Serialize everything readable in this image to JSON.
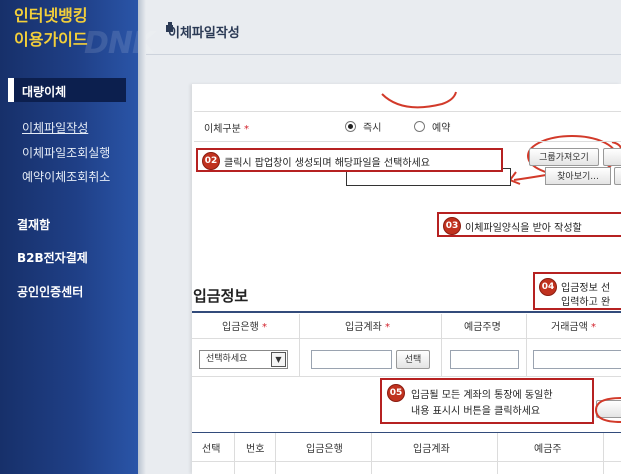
{
  "sidebar": {
    "brand_line1": "인터넷뱅킹",
    "brand_line2": "이용가이드",
    "brand_bg": "DNK",
    "active_item": "대량이체",
    "sub_items": [
      "이체파일작성",
      "이체파일조회실행",
      "예약이체조회취소"
    ],
    "main_items": [
      "결재함",
      "B2B전자결제",
      "공인인증센터"
    ]
  },
  "page": {
    "title": "이체파일작성"
  },
  "transfer_type": {
    "label": "이체구분",
    "required_mark": "*",
    "options": [
      "즉시",
      "예약"
    ],
    "selected": "즉시"
  },
  "file_buttons": {
    "group_import": "그룹가져오기",
    "browse": "찾아보기..."
  },
  "callouts": [
    {
      "num": "02",
      "text": "클릭시 팝업창이 생성되며 해당파일을 선택하세요"
    },
    {
      "num": "03",
      "text": "이체파일양식을  받아 작성할"
    },
    {
      "num": "04",
      "line1": "입금정보 선",
      "line2": "입력하고 완"
    },
    {
      "num": "05",
      "line1": "입금될 모든 계좌의 통장에 동일한",
      "line2": "내용 표시시 버튼을 클릭하세요"
    }
  ],
  "deposit_section": {
    "title": "입금정보",
    "headers": [
      "입금은행",
      "입금계좌",
      "예금주명",
      "거래금액"
    ],
    "bank_select_value": "선택하세요",
    "account_select_button": "선택"
  },
  "list_table": {
    "headers": [
      "선택",
      "번호",
      "입금은행",
      "입금계좌",
      "예금주"
    ]
  },
  "colors": {
    "sidebar": "#1f3f86",
    "brand_yellow": "#f3cf3a",
    "callout_red": "#b62121",
    "annotation_red": "#d23a2a"
  }
}
